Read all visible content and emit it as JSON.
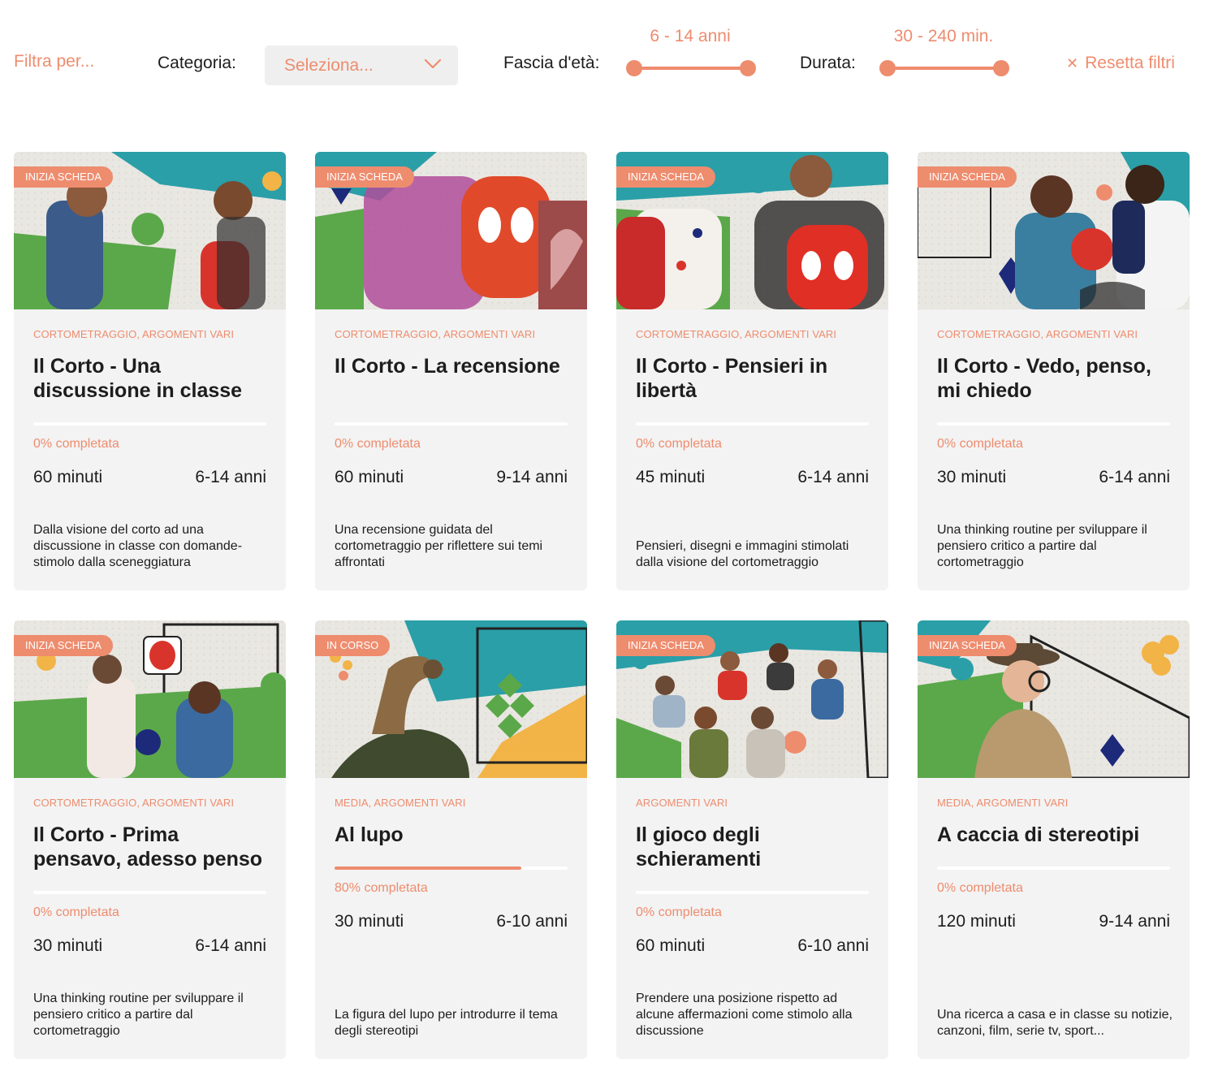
{
  "filters": {
    "filter_by_label": "Filtra per...",
    "category_label": "Categoria:",
    "category_value": "Seleziona...",
    "age_label": "Fascia d'età:",
    "age_range": "6 - 14 anni",
    "duration_label": "Durata:",
    "duration_range": "30 - 240 min.",
    "reset_label": "Resetta filtri"
  },
  "colors": {
    "accent": "#ee8c6e",
    "card_bg": "#f3f3f3",
    "teal": "#2a9fa8",
    "green": "#5ba84a",
    "navy": "#1d2a7a",
    "yellow": "#f2b447"
  },
  "cards": [
    {
      "badge": "INIZIA SCHEDA",
      "category": "CORTOMETRAGGIO, ARGOMENTI VARI",
      "title": "Il Corto - Una discussione in classe",
      "progress": 0,
      "progress_label": "0% completata",
      "duration": "60 minuti",
      "age": "6-14 anni",
      "description": "Dalla visione del corto ad una discussione in classe con domande-stimolo dalla sceneggiatura",
      "image": "collage-children-backpacks"
    },
    {
      "badge": "INIZIA SCHEDA",
      "category": "CORTOMETRAGGIO, ARGOMENTI VARI",
      "title": "Il Corto - La recensione",
      "progress": 0,
      "progress_label": "0% completata",
      "duration": "60 minuti",
      "age": "9-14 anni",
      "description": "Una recensione guidata del cortometraggio per riflettere sui temi affrontati",
      "image": "collage-spiderman-backpack"
    },
    {
      "badge": "INIZIA SCHEDA",
      "category": "CORTOMETRAGGIO, ARGOMENTI VARI",
      "title": "Il Corto - Pensieri in libertà",
      "progress": 0,
      "progress_label": "0% completata",
      "duration": "45 minuti",
      "age": "6-14 anni",
      "description": "Pensieri, disegni e immagini stimolati dalla visione del cortometraggio",
      "image": "collage-two-children-backs"
    },
    {
      "badge": "INIZIA SCHEDA",
      "category": "CORTOMETRAGGIO, ARGOMENTI VARI",
      "title": "Il Corto - Vedo, penso, mi chiedo",
      "progress": 0,
      "progress_label": "0% completata",
      "duration": "30 minuti",
      "age": "6-14 anni",
      "description": "Una thinking routine per sviluppare il pensiero critico a partire dal cortometraggio",
      "image": "collage-children-ball"
    },
    {
      "badge": "INIZIA SCHEDA",
      "category": "CORTOMETRAGGIO, ARGOMENTI VARI",
      "title": "Il Corto - Prima pensavo, adesso penso",
      "progress": 0,
      "progress_label": "0% completata",
      "duration": "30 minuti",
      "age": "6-14 anni",
      "description": "Una thinking routine per sviluppare il pensiero critico a partire dal cortometraggio",
      "image": "collage-girls-walking"
    },
    {
      "badge": "IN CORSO",
      "category": "MEDIA, ARGOMENTI VARI",
      "title": "Al lupo",
      "progress": 0.8,
      "progress_label": "80% completata",
      "duration": "30 minuti",
      "age": "6-10 anni",
      "description": "La figura del lupo per introdurre il tema degli stereotipi",
      "image": "collage-wolf"
    },
    {
      "badge": "INIZIA SCHEDA",
      "category": "ARGOMENTI VARI",
      "title": "Il gioco degli schieramenti",
      "progress": 0,
      "progress_label": "0% completata",
      "duration": "60 minuti",
      "age": "6-10 anni",
      "description": "Prendere una posizione rispetto ad alcune affermazioni come stimolo alla discussione",
      "image": "collage-children-sitting"
    },
    {
      "badge": "INIZIA SCHEDA",
      "category": "MEDIA, ARGOMENTI VARI",
      "title": "A caccia di stereotipi",
      "progress": 0,
      "progress_label": "0% completata",
      "duration": "120 minuti",
      "age": "9-14 anni",
      "description": "Una ricerca a casa e in classe su notizie, canzoni, film, serie tv, sport...",
      "image": "collage-detective-child"
    }
  ]
}
